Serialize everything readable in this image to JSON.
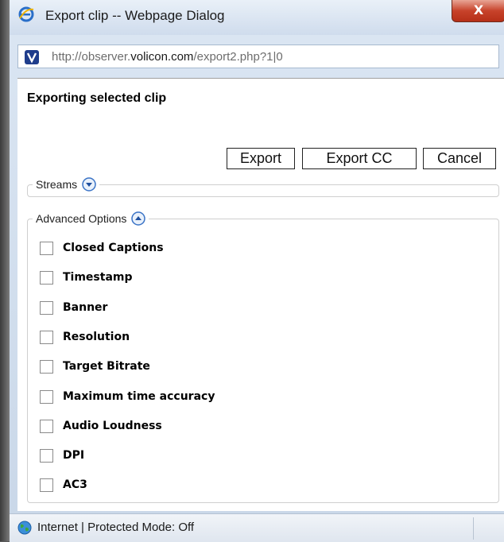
{
  "window": {
    "title": "Export clip -- Webpage Dialog",
    "close_label": "X"
  },
  "address": {
    "prefix": "http://observer.",
    "domain": "volicon.com",
    "suffix": "/export2.php?1|0"
  },
  "heading": "Exporting selected clip",
  "buttons": {
    "export": "Export",
    "export_cc": "Export CC",
    "cancel": "Cancel"
  },
  "streams": {
    "legend": "Streams",
    "icon": "chevron-down-icon"
  },
  "advanced": {
    "legend": "Advanced Options",
    "icon": "chevron-up-icon",
    "options": [
      {
        "label": "Closed Captions",
        "checked": false
      },
      {
        "label": "Timestamp",
        "checked": false
      },
      {
        "label": "Banner",
        "checked": false
      },
      {
        "label": "Resolution",
        "checked": false
      },
      {
        "label": "Target Bitrate",
        "checked": false
      },
      {
        "label": "Maximum time accuracy",
        "checked": false
      },
      {
        "label": "Audio Loudness",
        "checked": false
      },
      {
        "label": "DPI",
        "checked": false
      },
      {
        "label": "AC3",
        "checked": false
      }
    ]
  },
  "status": {
    "text": "Internet | Protected Mode: Off",
    "icon": "globe-icon"
  },
  "colors": {
    "titlebar": "#cfdced",
    "close_button": "#c7432b",
    "toggle_blue": "#3a73c6"
  }
}
